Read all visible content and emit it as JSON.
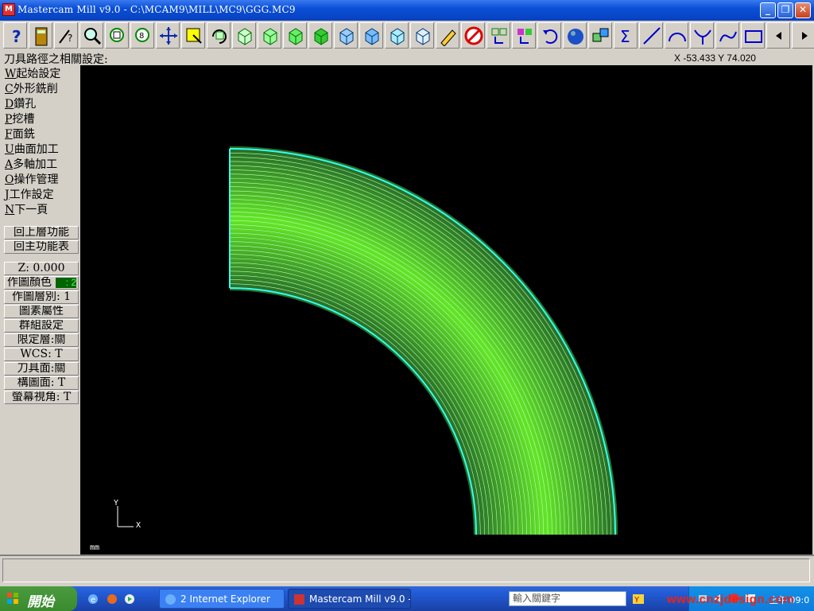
{
  "window": {
    "title": "Mastercam Mill v9.0 - C:\\MCAM9\\MILL\\MC9\\GGG.MC9",
    "app_icon_label": "M"
  },
  "toolbar": {
    "icons": [
      "help-icon",
      "calculator-icon",
      "analyze-icon",
      "zoom-icon",
      "zoom-window-icon",
      "zoom-fit-icon",
      "pan-icon",
      "select-icon",
      "rotate-icon",
      "view-top-icon",
      "view-front-icon",
      "view-side-icon",
      "view-iso-icon",
      "cube-1-icon",
      "cube-2-icon",
      "cube-3-icon",
      "cube-4-icon",
      "pencil-icon",
      "delete-icon",
      "move-icon",
      "copy-icon",
      "undo-icon",
      "sphere-icon",
      "transform-icon",
      "sum-icon",
      "line-icon",
      "arc-icon",
      "fillet-icon",
      "spline-icon",
      "rectangle-icon",
      "page-left-icon",
      "page-right-icon"
    ]
  },
  "status": {
    "prompt": "刀具路徑之相關設定:",
    "coords": "X -53.433  Y 74.020"
  },
  "menu": {
    "items": [
      {
        "key": "W",
        "label": "起始設定"
      },
      {
        "key": "C",
        "label": "外形銑削"
      },
      {
        "key": "D",
        "label": "鑽孔"
      },
      {
        "key": "P",
        "label": "挖槽"
      },
      {
        "key": "F",
        "label": "面銑"
      },
      {
        "key": "U",
        "label": "曲面加工"
      },
      {
        "key": "A",
        "label": "多軸加工"
      },
      {
        "key": "O",
        "label": "操作管理"
      },
      {
        "key": "J",
        "label": "工作設定"
      },
      {
        "key": "N",
        "label": "下一頁"
      }
    ],
    "back": "回上層功能",
    "main": "回主功能表"
  },
  "secondary": {
    "z": "Z:  0.000",
    "color_label": "作圖顏色",
    "color_value": ": 2",
    "level": "作圖層別: 1",
    "attributes": "圖素屬性",
    "groups": "群組設定",
    "mask": "限定層:關",
    "wcs": "WCS:  T",
    "tplane": "刀具面:關",
    "cplane": "構圖面: T",
    "gview": "螢幕視角: T"
  },
  "viewport": {
    "axis_y": "Y",
    "axis_x": "X",
    "units": "mm",
    "background": "#000000",
    "toolpath_color": "#22dd22",
    "edge_color": "#33ffee"
  },
  "taskbar": {
    "start": "開始",
    "tasks": [
      {
        "label": "2 Internet Explorer"
      },
      {
        "label": "Mastercam Mill v9.0 - ..."
      }
    ],
    "search_placeholder": "輸入關鍵字",
    "clock": "上午 09:0"
  },
  "watermark": "www.cnzjdesign.com"
}
